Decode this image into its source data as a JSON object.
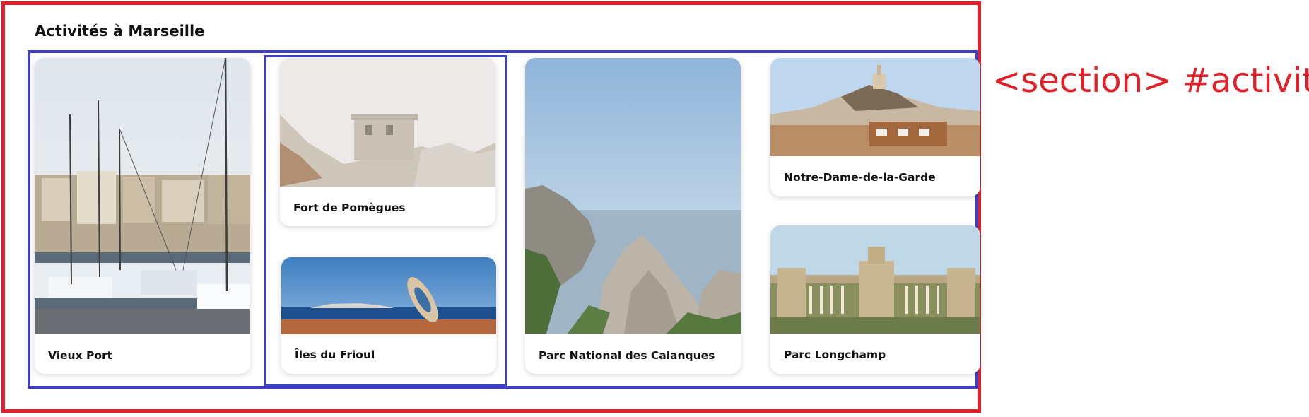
{
  "section": {
    "heading": "Activités à Marseille",
    "label": "<section> #activites"
  },
  "cards": [
    {
      "title": "Vieux Port",
      "image": "harbour-boats-photo"
    },
    {
      "title": "Fort de Pomègues",
      "image": "fort-on-rocks-photo"
    },
    {
      "title": "Îles du Frioul",
      "image": "islands-sea-telescope-photo"
    },
    {
      "title": "Parc National des Calanques",
      "image": "calanques-cliffs-photo"
    },
    {
      "title": "Notre-Dame-de-la-Garde",
      "image": "basilica-hill-photo"
    },
    {
      "title": "Parc Longchamp",
      "image": "palais-longchamp-photo"
    }
  ],
  "colors": {
    "annotation_red": "#e02129",
    "annotation_blue": "#3d3fc7"
  }
}
